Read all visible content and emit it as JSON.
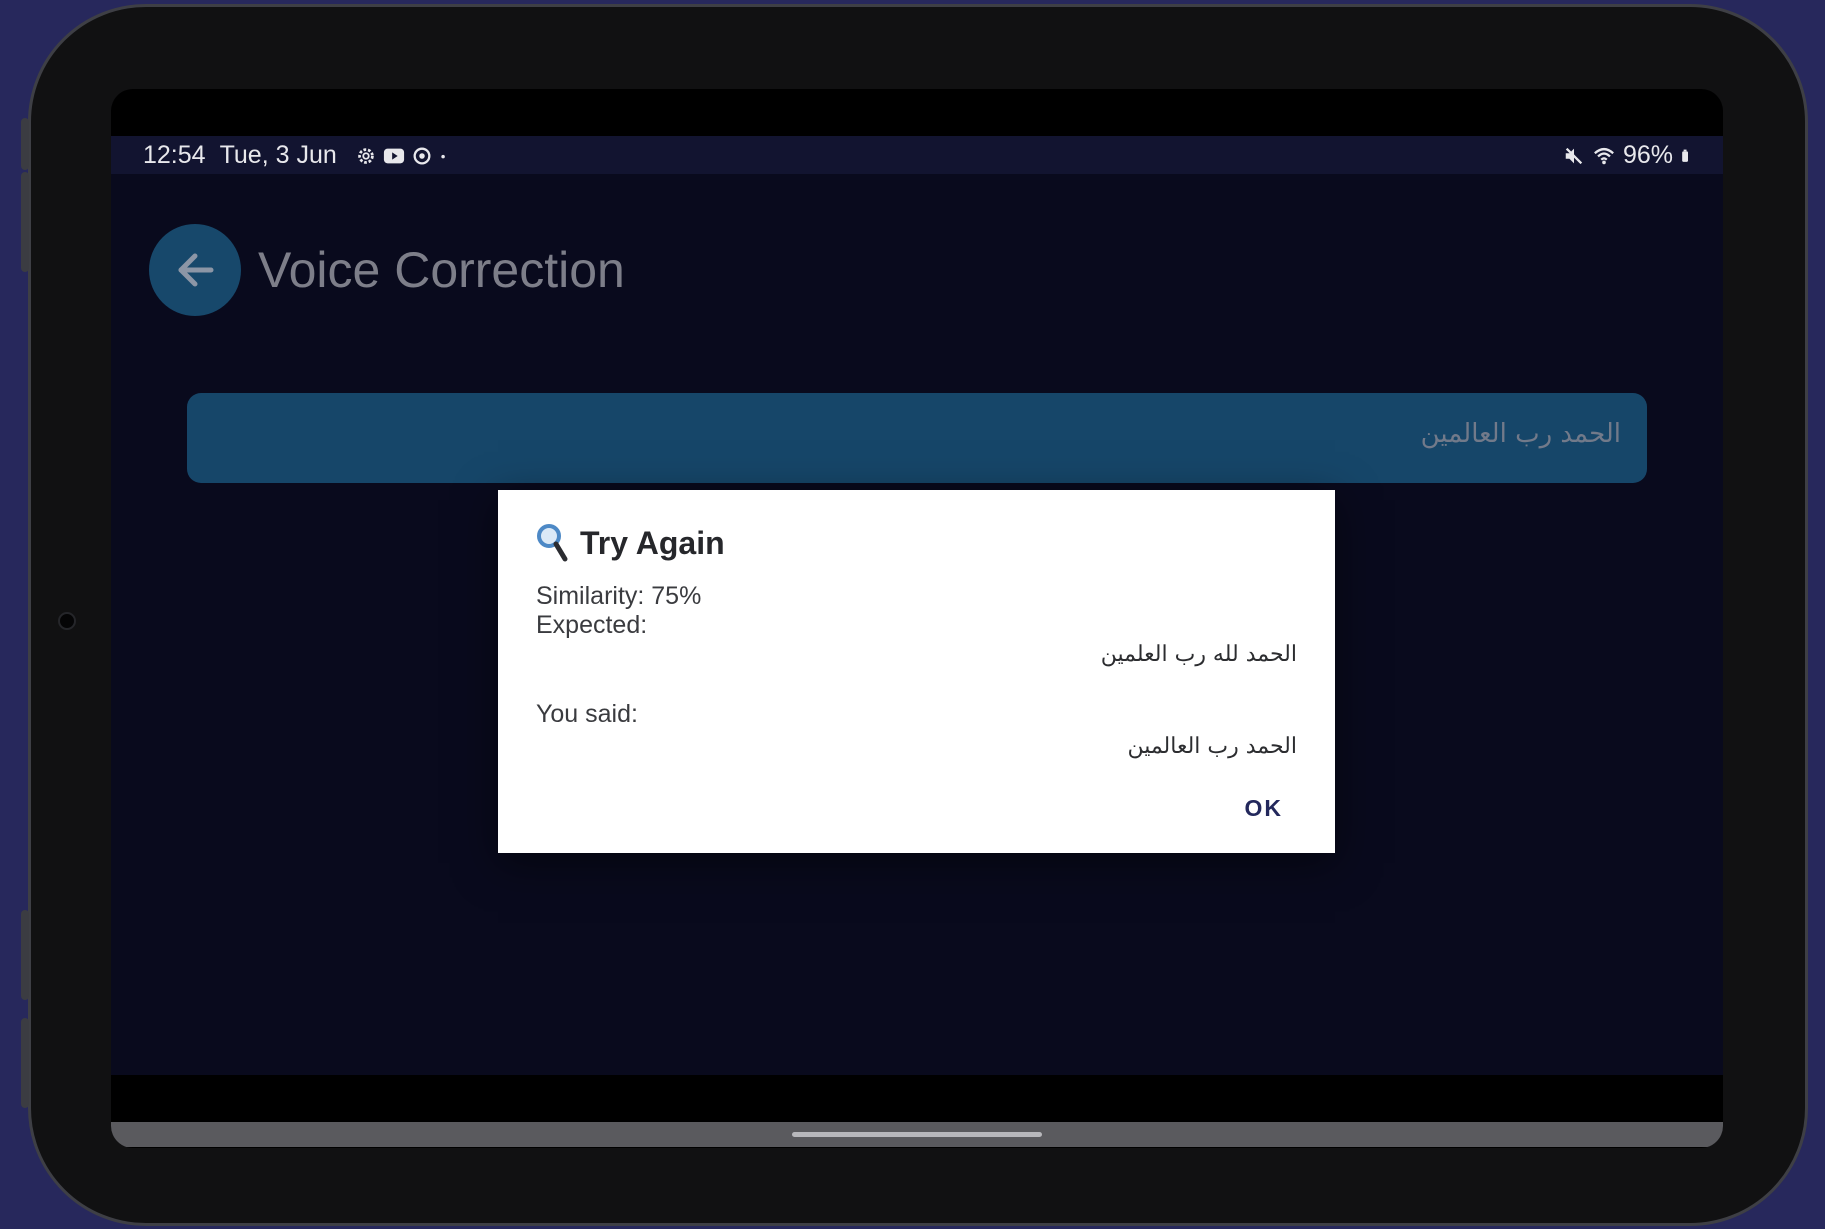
{
  "status_bar": {
    "time": "12:54",
    "date": "Tue, 3 Jun",
    "notification_icons": [
      "settings-icon",
      "youtube-icon",
      "sync-icon",
      "dot-icon"
    ],
    "battery": "96%"
  },
  "app_bar": {
    "title": "Voice Correction"
  },
  "phrase": {
    "text": "الحمد رب العالمين"
  },
  "dialog": {
    "icon": "magnifier-icon",
    "title": "Try Again",
    "similarity": "Similarity: 75%",
    "expected_label": "Expected:",
    "expected_text": "الحمد لله رب العلمين",
    "you_said_label": "You said:",
    "you_said_text": "الحمد رب العالمين",
    "ok_label": "OK"
  },
  "colors": {
    "background": "#27285c",
    "app_background": "#090a1d",
    "accent": "#164669",
    "ok_text": "#23285c"
  }
}
